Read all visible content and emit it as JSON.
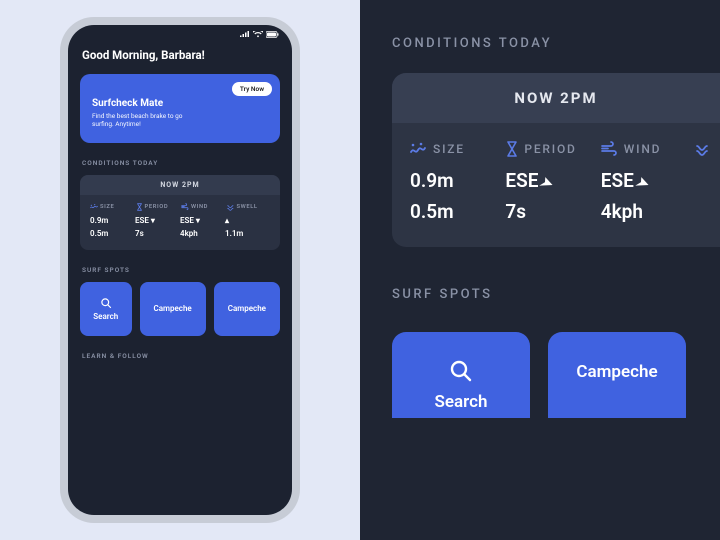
{
  "colors": {
    "accent": "#4062e0",
    "bg_dark": "#1c2230",
    "panel": "#2a3142"
  },
  "greeting": "Good Morning, Barbara!",
  "hero": {
    "title": "Surfcheck Mate",
    "subtitle": "Find the best beach brake to go surfing. Anytime!",
    "cta": "Try Now"
  },
  "conditions": {
    "section_label": "CONDITIONS TODAY",
    "time_label": "NOW 2PM",
    "metrics": [
      {
        "icon": "wave-icon",
        "label": "SIZE",
        "row1": "0.9m",
        "row2": "0.5m"
      },
      {
        "icon": "hourglass-icon",
        "label": "PERIOD",
        "row1": "ESE ▾",
        "row2": "7s"
      },
      {
        "icon": "wind-icon",
        "label": "WIND",
        "row1": "ESE ▾",
        "row2": "4kph"
      },
      {
        "icon": "swell-icon",
        "label": "SWELL",
        "row1": "▴",
        "row2": "1.1m"
      }
    ]
  },
  "surf_spots": {
    "section_label": "SURF SPOTS",
    "search_label": "Search",
    "spots": [
      "Campeche",
      "Campeche"
    ]
  },
  "learn": {
    "section_label": "LEARN & FOLLOW"
  },
  "closeup": {
    "conditions_label": "CONDITIONS TODAY",
    "time_label": "NOW 2PM",
    "metrics": [
      {
        "icon": "wave-icon",
        "label": "SIZE",
        "row1": "0.9m",
        "row2": "0.5m"
      },
      {
        "icon": "hourglass-icon",
        "label": "PERIOD",
        "row1": "ESE",
        "row2": "7s",
        "arrow": true
      },
      {
        "icon": "wind-icon",
        "label": "WIND",
        "row1": "ESE",
        "row2": "4kph",
        "arrow": true
      },
      {
        "icon": "swell-icon",
        "label": "",
        "row1": "",
        "row2": ""
      }
    ],
    "spots_label": "SURF SPOTS",
    "search_label": "Search",
    "spot1": "Campeche"
  }
}
